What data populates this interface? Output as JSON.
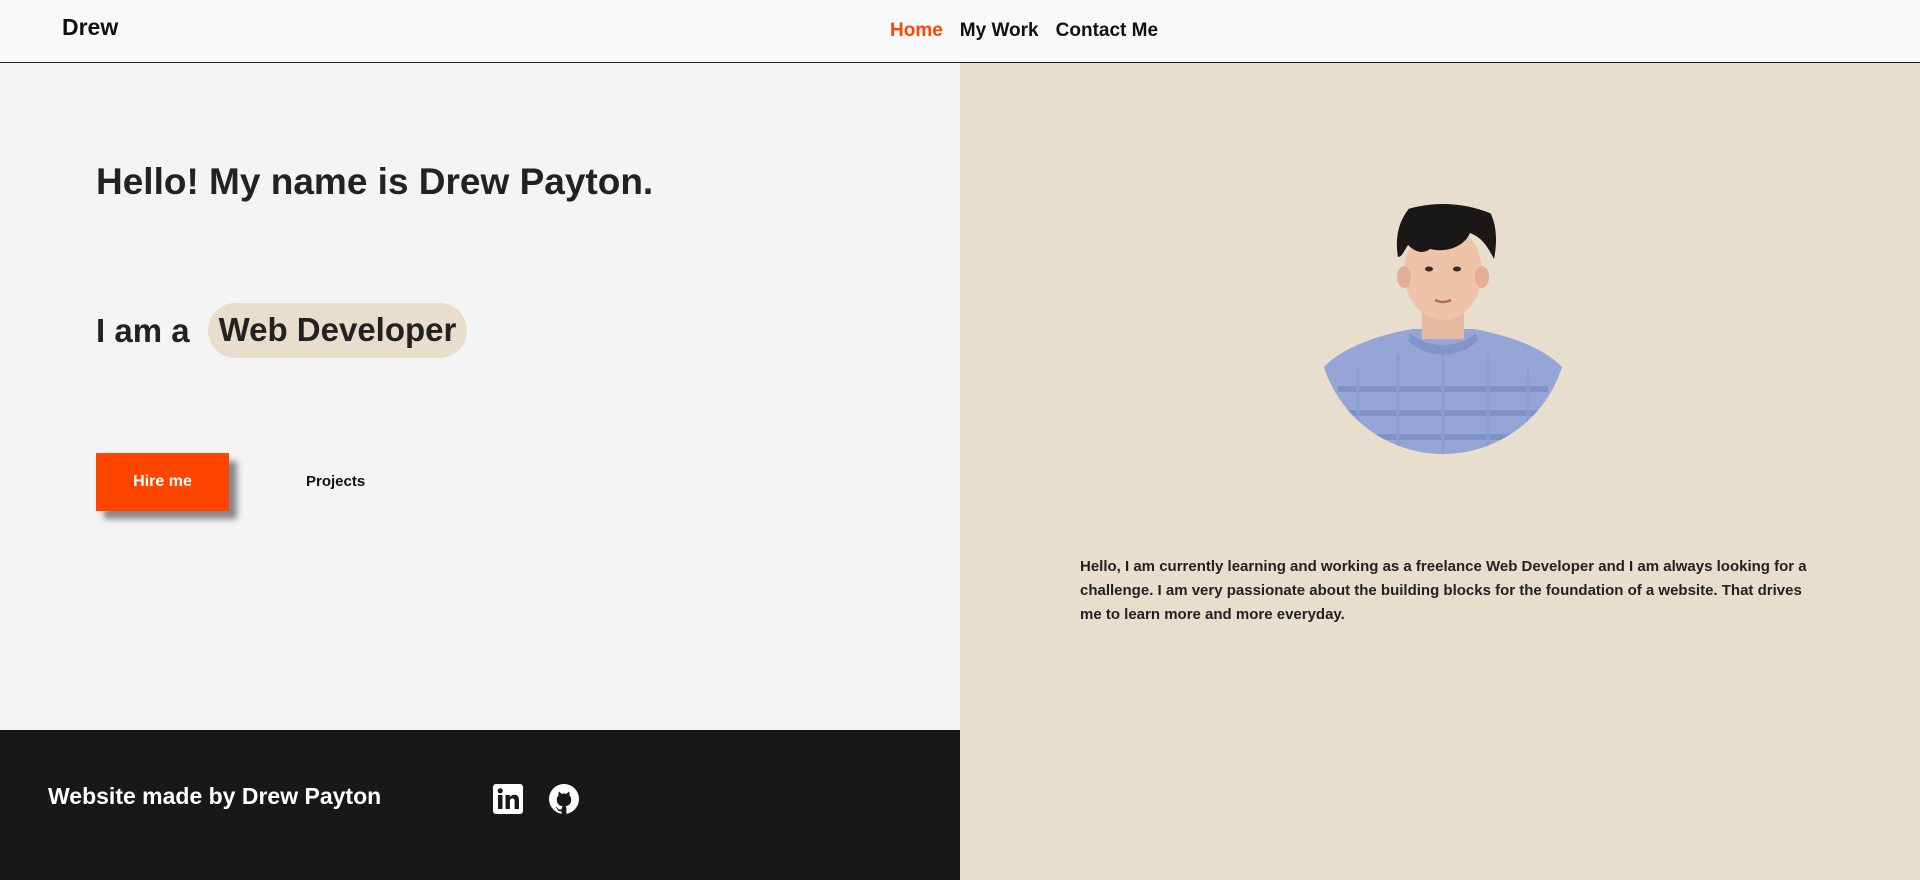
{
  "nav": {
    "brand": "Drew",
    "links": [
      {
        "label": "Home",
        "active": true
      },
      {
        "label": "My Work",
        "active": false
      },
      {
        "label": "Contact Me",
        "active": false
      }
    ]
  },
  "hero": {
    "greeting": "Hello! My name is Drew Payton.",
    "role_prefix": "I am a",
    "role": "Web Developer",
    "primary_button": "Hire me",
    "secondary_link": "Projects"
  },
  "about": {
    "text": "Hello, I am currently learning and working as a freelance Web Developer and I am always looking for a challenge. I am very passionate about the building blocks for the foundation of a website. That drives me to learn more and more everyday."
  },
  "footer": {
    "credit": "Website made by Drew Payton",
    "social_icons": [
      "linkedin-icon",
      "github-icon"
    ]
  },
  "colors": {
    "accent": "#ff4500",
    "beige": "#e7dece",
    "footer_bg": "#181818",
    "light_bg": "#f4f4f4"
  }
}
